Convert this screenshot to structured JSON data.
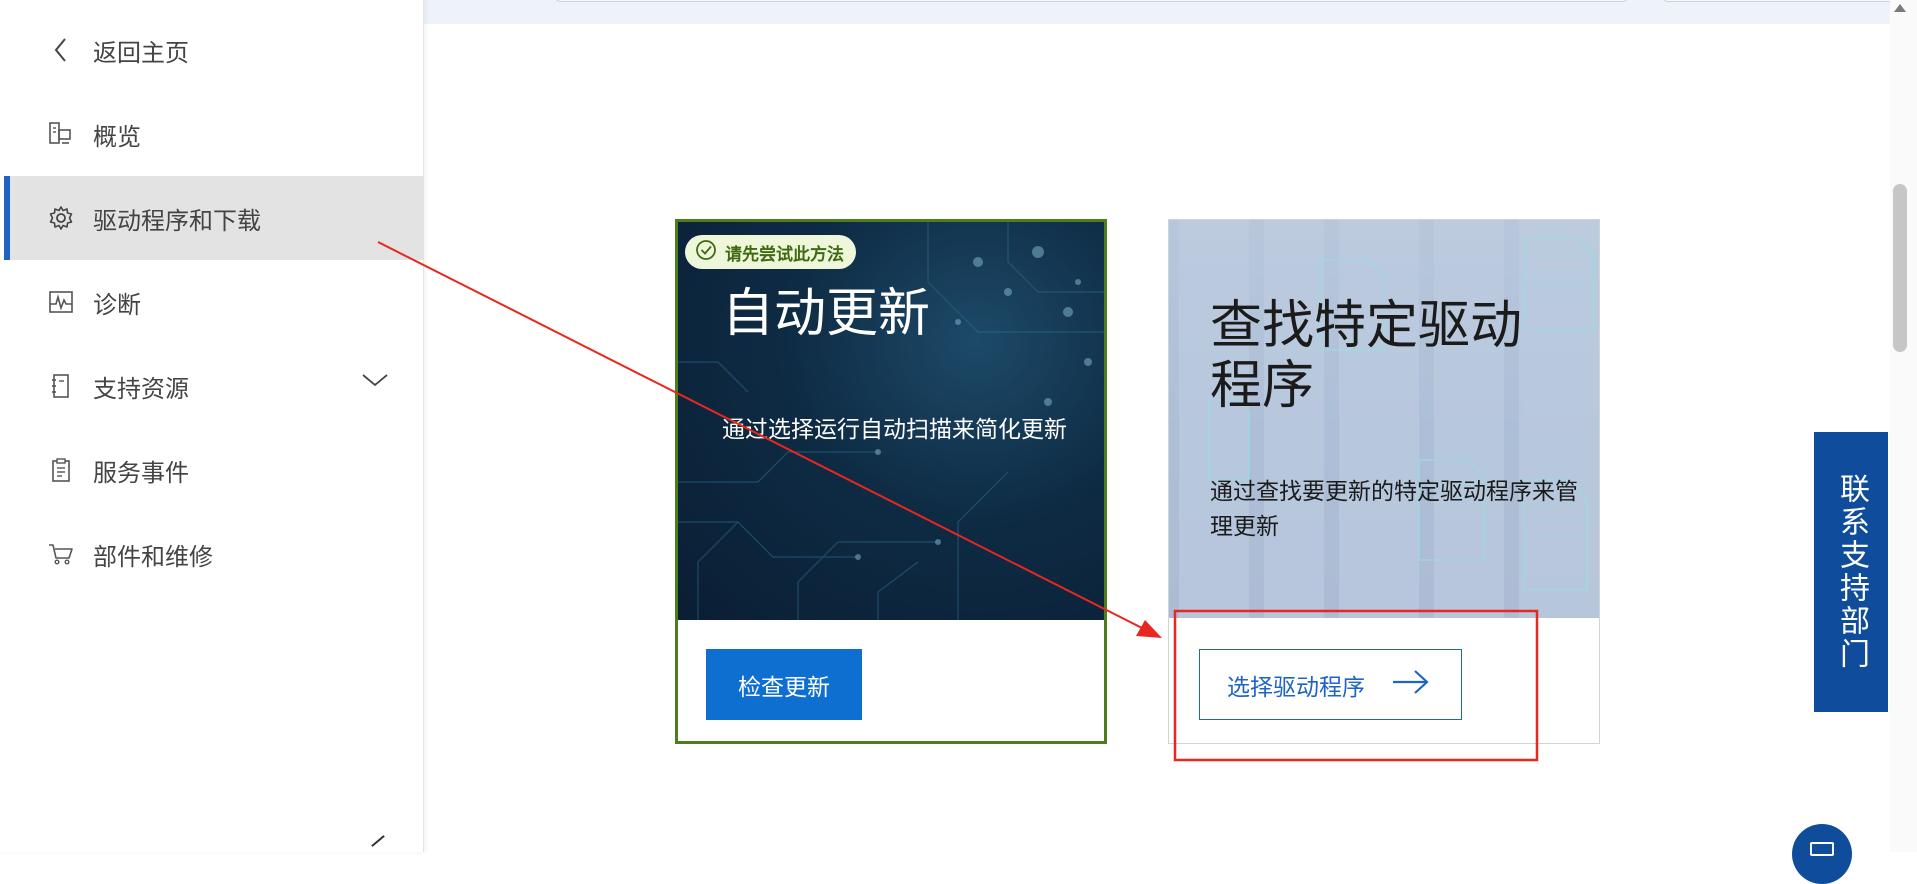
{
  "sidebar": {
    "items": [
      {
        "label": "返回主页",
        "icon": "chevron-left-icon"
      },
      {
        "label": "概览",
        "icon": "overview-icon"
      },
      {
        "label": "驱动程序和下载",
        "icon": "gear-icon",
        "active": true
      },
      {
        "label": "诊断",
        "icon": "pulse-icon"
      },
      {
        "label": "支持资源",
        "icon": "book-icon",
        "expandable": true
      },
      {
        "label": "服务事件",
        "icon": "clipboard-icon"
      },
      {
        "label": "部件和维修",
        "icon": "cart-icon"
      }
    ]
  },
  "cards": {
    "auto": {
      "badge": "请先尝试此方法",
      "title": "自动更新",
      "description": "通过选择运行自动扫描来简化更新",
      "button": "检查更新"
    },
    "find": {
      "title": "查找特定驱动程序",
      "description": "通过查找要更新的特定驱动程序来管理更新",
      "button": "选择驱动程序"
    }
  },
  "side_tab": {
    "label": "联系支持部门"
  },
  "colors": {
    "accent": "#0f6fd1",
    "active_bar": "#1f63c4",
    "recommended_border": "#4e7d1e",
    "side_tab": "#0f4d9c",
    "annotation": "#e8271f"
  }
}
